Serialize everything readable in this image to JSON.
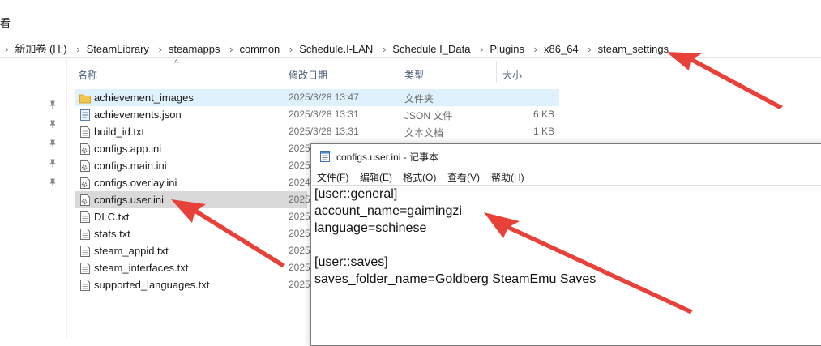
{
  "top": {
    "char": "看"
  },
  "address": {
    "segments": [
      "新加卷 (H:)",
      "SteamLibrary",
      "steamapps",
      "common",
      "Schedule.I-LAN",
      "Schedule I_Data",
      "Plugins",
      "x86_64",
      "steam_settings"
    ]
  },
  "columns": {
    "name": "名称",
    "date": "修改日期",
    "type": "类型",
    "size": "大小"
  },
  "files": [
    {
      "name": "achievement_images",
      "date": "2025/3/28 13:47",
      "type": "文件夹",
      "size": "",
      "icon": "folder-icon"
    },
    {
      "name": "achievements.json",
      "date": "2025/3/28 13:31",
      "type": "JSON 文件",
      "size": "6 KB",
      "icon": "json-file-icon"
    },
    {
      "name": "build_id.txt",
      "date": "2025/3/28 13:31",
      "type": "文本文档",
      "size": "1 KB",
      "icon": "text-file-icon"
    },
    {
      "name": "configs.app.ini",
      "date": "2025",
      "type": "",
      "size": "",
      "icon": "ini-file-icon"
    },
    {
      "name": "configs.main.ini",
      "date": "2025",
      "type": "",
      "size": "",
      "icon": "ini-file-icon"
    },
    {
      "name": "configs.overlay.ini",
      "date": "2024",
      "type": "",
      "size": "",
      "icon": "ini-file-icon"
    },
    {
      "name": "configs.user.ini",
      "date": "2025",
      "type": "",
      "size": "",
      "icon": "ini-file-icon"
    },
    {
      "name": "DLC.txt",
      "date": "2025",
      "type": "",
      "size": "",
      "icon": "text-file-icon"
    },
    {
      "name": "stats.txt",
      "date": "2025",
      "type": "",
      "size": "",
      "icon": "text-file-icon"
    },
    {
      "name": "steam_appid.txt",
      "date": "2025",
      "type": "",
      "size": "",
      "icon": "text-file-icon"
    },
    {
      "name": "steam_interfaces.txt",
      "date": "2025",
      "type": "",
      "size": "",
      "icon": "text-file-icon"
    },
    {
      "name": "supported_languages.txt",
      "date": "2025",
      "type": "",
      "size": "",
      "icon": "text-file-icon"
    }
  ],
  "notepad": {
    "title": "configs.user.ini - 记事本",
    "menu": [
      "文件(F)",
      "编辑(E)",
      "格式(O)",
      "查看(V)",
      "帮助(H)"
    ],
    "lines": [
      "[user::general]",
      "account_name=gaimingzi",
      "language=schinese",
      "",
      "[user::saves]",
      "saves_folder_name=Goldberg SteamEmu Saves"
    ]
  },
  "colors": {
    "annotation_arrow": "#e8413a",
    "hover_row": "#dff1fd",
    "selected_row": "#d9d9d9",
    "folder": "#f3c64f"
  }
}
